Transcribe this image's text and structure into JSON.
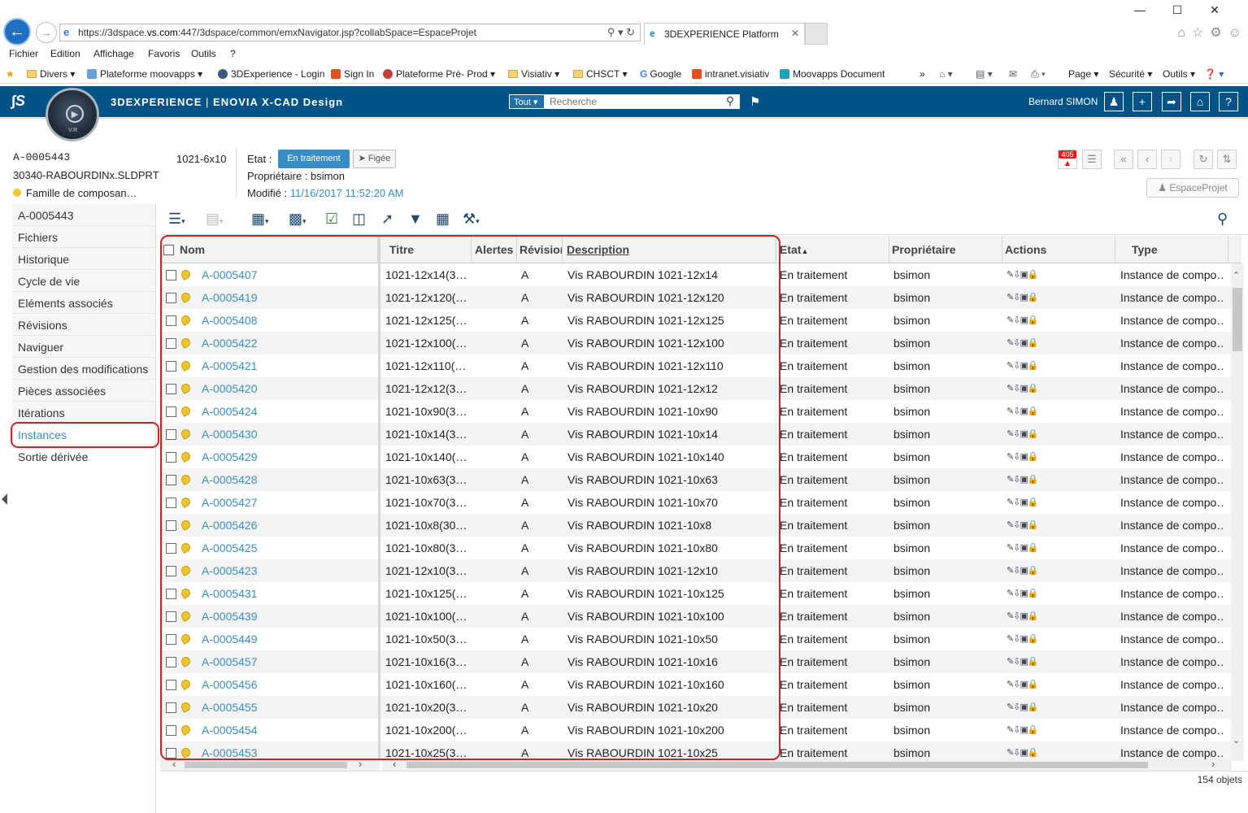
{
  "browser": {
    "address": "https://3dspace.vs.com:447/3dspace/common/emxNavigator.jsp?collabSpace=EspaceProjet",
    "address_pre": "https://3dspace.",
    "address_domain": "vs.com",
    "address_post": ":447/3dspace/common/emxNavigator.jsp?collabSpace=EspaceProjet",
    "tab_title": "3DEXPERIENCE Platform",
    "menu": [
      "Fichier",
      "Edition",
      "Affichage",
      "Favoris",
      "Outils",
      "?"
    ],
    "favorites": [
      "Divers",
      "Plateforme moovapps",
      "3DExperience - Login",
      "Sign In",
      "Plateforme Pré- Prod",
      "Visiativ",
      "CHSCT",
      "Google",
      "intranet.visiativ",
      "Moovapps Document"
    ],
    "fav_tools": [
      "Page",
      "Sécurité",
      "Outils"
    ]
  },
  "app": {
    "brand": "3DEXPERIENCE",
    "product": "ENOVIA X-CAD Design",
    "search_scope": "Tout",
    "search_placeholder": "Recherche",
    "user": "Bernard SIMON",
    "compass_label": "V.R"
  },
  "object": {
    "id": "A-0005443",
    "file": "30340-RABOURDINx.SLDPRT",
    "family": "Famille de composan…",
    "size": "1021-6x10",
    "etat_label": "Etat :",
    "state": "En traitement",
    "next_state": "Figée",
    "owner": "Propriétaire : bsimon",
    "modified_label": "Modifié :",
    "modified_value": "11/16/2017 11:52:20 AM",
    "notif_count": "405",
    "collab_space": "EspaceProjet"
  },
  "sidebar": {
    "items": [
      {
        "label": "A-0005443"
      },
      {
        "label": "Fichiers"
      },
      {
        "label": "Historique"
      },
      {
        "label": "Cycle de vie"
      },
      {
        "label": "Eléments associés"
      },
      {
        "label": "Révisions"
      },
      {
        "label": "Naviguer"
      },
      {
        "label": "Gestion des modifications"
      },
      {
        "label": "Pièces associées"
      },
      {
        "label": "Itérations"
      },
      {
        "label": "Instances"
      },
      {
        "label": "Sortie dérivée"
      }
    ]
  },
  "table": {
    "columns": [
      "Nom",
      "Titre",
      "Alertes",
      "Révision",
      "Description",
      "Etat",
      "Propriétaire",
      "Actions",
      "Type"
    ],
    "rows": [
      {
        "name": "A-0005407",
        "title": "1021-12x14(3…",
        "rev": "A",
        "desc": "Vis RABOURDIN 1021-12x14",
        "state": "En traitement",
        "owner": "bsimon",
        "type": "Instance de compo…"
      },
      {
        "name": "A-0005419",
        "title": "1021-12x120(…",
        "rev": "A",
        "desc": "Vis RABOURDIN 1021-12x120",
        "state": "En traitement",
        "owner": "bsimon",
        "type": "Instance de compo…"
      },
      {
        "name": "A-0005408",
        "title": "1021-12x125(…",
        "rev": "A",
        "desc": "Vis RABOURDIN 1021-12x125",
        "state": "En traitement",
        "owner": "bsimon",
        "type": "Instance de compo…"
      },
      {
        "name": "A-0005422",
        "title": "1021-12x100(…",
        "rev": "A",
        "desc": "Vis RABOURDIN 1021-12x100",
        "state": "En traitement",
        "owner": "bsimon",
        "type": "Instance de compo…"
      },
      {
        "name": "A-0005421",
        "title": "1021-12x110(…",
        "rev": "A",
        "desc": "Vis RABOURDIN 1021-12x110",
        "state": "En traitement",
        "owner": "bsimon",
        "type": "Instance de compo…"
      },
      {
        "name": "A-0005420",
        "title": "1021-12x12(3…",
        "rev": "A",
        "desc": "Vis RABOURDIN 1021-12x12",
        "state": "En traitement",
        "owner": "bsimon",
        "type": "Instance de compo…"
      },
      {
        "name": "A-0005424",
        "title": "1021-10x90(3…",
        "rev": "A",
        "desc": "Vis RABOURDIN 1021-10x90",
        "state": "En traitement",
        "owner": "bsimon",
        "type": "Instance de compo…"
      },
      {
        "name": "A-0005430",
        "title": "1021-10x14(3…",
        "rev": "A",
        "desc": "Vis RABOURDIN 1021-10x14",
        "state": "En traitement",
        "owner": "bsimon",
        "type": "Instance de compo…"
      },
      {
        "name": "A-0005429",
        "title": "1021-10x140(…",
        "rev": "A",
        "desc": "Vis RABOURDIN 1021-10x140",
        "state": "En traitement",
        "owner": "bsimon",
        "type": "Instance de compo…"
      },
      {
        "name": "A-0005428",
        "title": "1021-10x63(3…",
        "rev": "A",
        "desc": "Vis RABOURDIN 1021-10x63",
        "state": "En traitement",
        "owner": "bsimon",
        "type": "Instance de compo…"
      },
      {
        "name": "A-0005427",
        "title": "1021-10x70(3…",
        "rev": "A",
        "desc": "Vis RABOURDIN 1021-10x70",
        "state": "En traitement",
        "owner": "bsimon",
        "type": "Instance de compo…"
      },
      {
        "name": "A-0005426",
        "title": "1021-10x8(30…",
        "rev": "A",
        "desc": "Vis RABOURDIN 1021-10x8",
        "state": "En traitement",
        "owner": "bsimon",
        "type": "Instance de compo…"
      },
      {
        "name": "A-0005425",
        "title": "1021-10x80(3…",
        "rev": "A",
        "desc": "Vis RABOURDIN 1021-10x80",
        "state": "En traitement",
        "owner": "bsimon",
        "type": "Instance de compo…"
      },
      {
        "name": "A-0005423",
        "title": "1021-12x10(3…",
        "rev": "A",
        "desc": "Vis RABOURDIN 1021-12x10",
        "state": "En traitement",
        "owner": "bsimon",
        "type": "Instance de compo…"
      },
      {
        "name": "A-0005431",
        "title": "1021-10x125(…",
        "rev": "A",
        "desc": "Vis RABOURDIN 1021-10x125",
        "state": "En traitement",
        "owner": "bsimon",
        "type": "Instance de compo…"
      },
      {
        "name": "A-0005439",
        "title": "1021-10x100(…",
        "rev": "A",
        "desc": "Vis RABOURDIN 1021-10x100",
        "state": "En traitement",
        "owner": "bsimon",
        "type": "Instance de compo…"
      },
      {
        "name": "A-0005449",
        "title": "1021-10x50(3…",
        "rev": "A",
        "desc": "Vis RABOURDIN 1021-10x50",
        "state": "En traitement",
        "owner": "bsimon",
        "type": "Instance de compo…"
      },
      {
        "name": "A-0005457",
        "title": "1021-10x16(3…",
        "rev": "A",
        "desc": "Vis RABOURDIN 1021-10x16",
        "state": "En traitement",
        "owner": "bsimon",
        "type": "Instance de compo…"
      },
      {
        "name": "A-0005456",
        "title": "1021-10x160(…",
        "rev": "A",
        "desc": "Vis RABOURDIN 1021-10x160",
        "state": "En traitement",
        "owner": "bsimon",
        "type": "Instance de compo…"
      },
      {
        "name": "A-0005455",
        "title": "1021-10x20(3…",
        "rev": "A",
        "desc": "Vis RABOURDIN 1021-10x20",
        "state": "En traitement",
        "owner": "bsimon",
        "type": "Instance de compo…"
      },
      {
        "name": "A-0005454",
        "title": "1021-10x200(…",
        "rev": "A",
        "desc": "Vis RABOURDIN 1021-10x200",
        "state": "En traitement",
        "owner": "bsimon",
        "type": "Instance de compo…"
      },
      {
        "name": "A-0005453",
        "title": "1021-10x25(3…",
        "rev": "A",
        "desc": "Vis RABOURDIN 1021-10x25",
        "state": "En traitement",
        "owner": "bsimon",
        "type": "Instance de compo…"
      }
    ],
    "count": "154 objets"
  },
  "colors": {
    "header": "#005386",
    "accent": "#368ec4",
    "highlight": "#d32020"
  }
}
